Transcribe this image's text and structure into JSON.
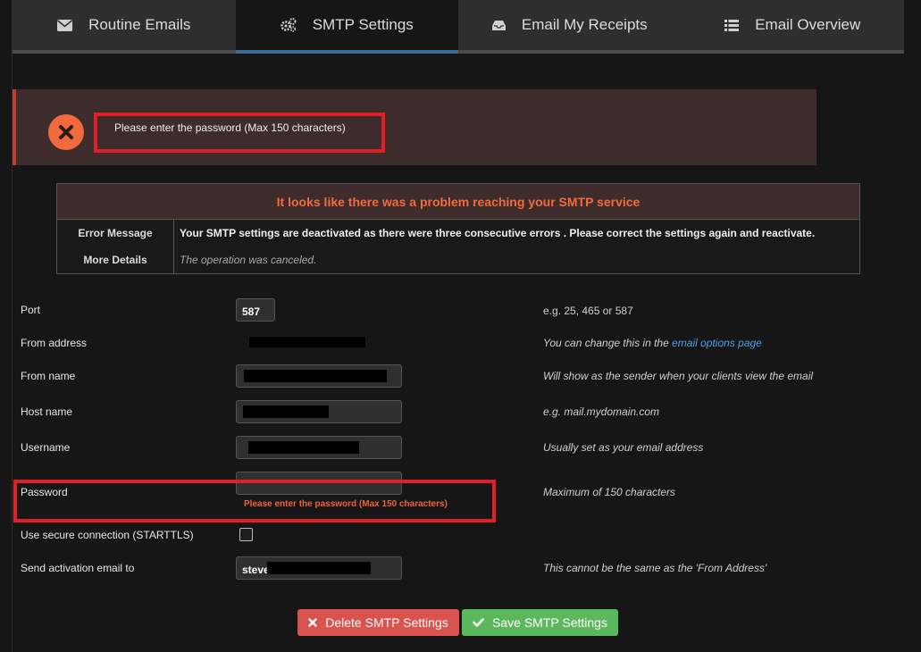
{
  "tabs": [
    {
      "label": "Routine Emails",
      "icon": "envelope-icon"
    },
    {
      "label": "SMTP Settings",
      "icon": "gears-icon"
    },
    {
      "label": "Email My Receipts",
      "icon": "inbox-icon"
    },
    {
      "label": "Email Overview",
      "icon": "list-icon"
    }
  ],
  "banner": {
    "message": "Please enter the password (Max 150 characters)"
  },
  "problem": {
    "title": "It looks like there was a problem reaching your SMTP service",
    "error_label": "Error Message",
    "error_text": "Your SMTP settings are deactivated as there were three consecutive errors . Please correct the settings again and reactivate.",
    "details_label": "More Details",
    "details_text": "The operation was canceled."
  },
  "form": {
    "port": {
      "label": "Port",
      "value": "587",
      "hint": "e.g. 25, 465 or 587"
    },
    "from_address": {
      "label": "From address",
      "hint_prefix": "You can change this in the ",
      "hint_link": "email options page"
    },
    "from_name": {
      "label": "From name",
      "hint": "Will show as the sender when your clients view the email"
    },
    "host_name": {
      "label": "Host name",
      "hint": "e.g. mail.mydomain.com"
    },
    "username": {
      "label": "Username",
      "hint": "Usually set as your email address"
    },
    "password": {
      "label": "Password",
      "value": "",
      "hint": "Maximum of 150 characters",
      "error": "Please enter the password (Max 150 characters)"
    },
    "secure": {
      "label": "Use secure connection (STARTTLS)",
      "checked": false
    },
    "activation": {
      "label": "Send activation email to",
      "value": "steve",
      "hint": "This cannot be the same as the 'From Address'"
    }
  },
  "buttons": {
    "delete": "Delete SMTP Settings",
    "save": "Save SMTP Settings"
  },
  "colors": {
    "error": "#f26b3a",
    "highlight": "#e01f26",
    "delete": "#d9534f",
    "save": "#5cb85c",
    "tab_active": "#3a6a9a"
  }
}
